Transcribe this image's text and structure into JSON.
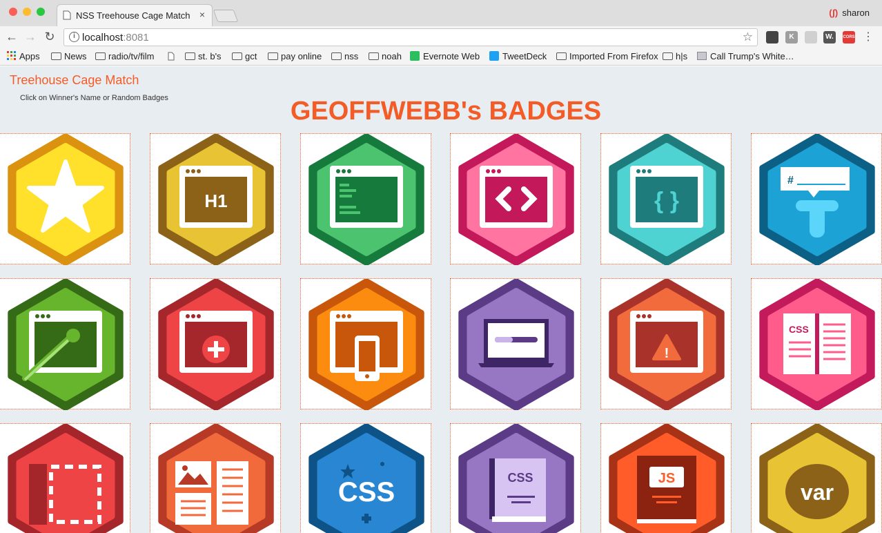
{
  "browser": {
    "tab_title": "NSS Treehouse Cage Match",
    "tab_close": "×",
    "profile_name": "sharon",
    "url_host": "localhost",
    "url_port": ":8081",
    "back_icon": "←",
    "forward_icon": "→",
    "reload_icon": "↻",
    "info_icon": "i",
    "star_icon": "☆",
    "menu_icon": "⋮",
    "extensions": [
      {
        "name": "evernote-ext-icon",
        "label": "",
        "color": "#444444"
      },
      {
        "name": "k-ext-icon",
        "label": "K",
        "color": "#9e9e9e"
      },
      {
        "name": "blank-ext-icon",
        "label": "",
        "color": "#d0d0d0"
      },
      {
        "name": "w-ext-icon",
        "label": "W.",
        "color": "#555555"
      },
      {
        "name": "cors-ext-icon",
        "label": "CORS",
        "color": "#e53935"
      }
    ],
    "bookmarks": [
      "Apps",
      "News",
      "radio/tv/film",
      "",
      "st. b's",
      "gct",
      "pay online",
      "nss",
      "noah",
      "Evernote Web",
      "TweetDeck",
      "Imported From Firefox",
      "h|s",
      "Call Trump's White…"
    ]
  },
  "page": {
    "site_title": "Treehouse Cage Match",
    "hint": "Click on Winner's Name or Random Badges",
    "heading": "GEOFFWEBB's BADGES"
  },
  "badges": [
    {
      "name": "star",
      "outer": "#da9210",
      "inner": "#ffe02a",
      "text": ""
    },
    {
      "name": "html-h1",
      "outer": "#8c6219",
      "inner": "#e8c435",
      "text": "H1"
    },
    {
      "name": "console",
      "outer": "#157a3b",
      "inner": "#4cc36e",
      "text": ""
    },
    {
      "name": "code",
      "outer": "#c3195a",
      "inner": "#ff74a0",
      "text": ""
    },
    {
      "name": "css-braces",
      "outer": "#1f7c7d",
      "inner": "#4fd2d2",
      "text": "{ }"
    },
    {
      "name": "hashtag",
      "outer": "#0c5f85",
      "inner": "#1da2d5",
      "text": "#"
    },
    {
      "name": "paint",
      "outer": "#356a16",
      "inner": "#67b52d",
      "text": ""
    },
    {
      "name": "add",
      "outer": "#a5272c",
      "inner": "#ef4446",
      "text": "+"
    },
    {
      "name": "responsive",
      "outer": "#c8570b",
      "inner": "#fb8c0f",
      "text": ""
    },
    {
      "name": "laptop",
      "outer": "#5c3b86",
      "inner": "#9776c4",
      "text": ""
    },
    {
      "name": "warning",
      "outer": "#a9322a",
      "inner": "#f26b3c",
      "text": "!"
    },
    {
      "name": "css-book",
      "outer": "#c31a5b",
      "inner": "#ff5c8c",
      "text": "CSS"
    },
    {
      "name": "layout",
      "outer": "#a5262a",
      "inner": "#ef4446",
      "text": ""
    },
    {
      "name": "media",
      "outer": "#b73a26",
      "inner": "#f16a3c",
      "text": ""
    },
    {
      "name": "css",
      "outer": "#0d5387",
      "inner": "#2886d3",
      "text": "CSS"
    },
    {
      "name": "css-book-purple",
      "outer": "#5c3b86",
      "inner": "#9776c4",
      "text": "CSS"
    },
    {
      "name": "js-book",
      "outer": "#a73216",
      "inner": "#ff5c29",
      "text": "JS"
    },
    {
      "name": "var",
      "outer": "#8c6219",
      "inner": "#e8c435",
      "text": "var"
    }
  ]
}
